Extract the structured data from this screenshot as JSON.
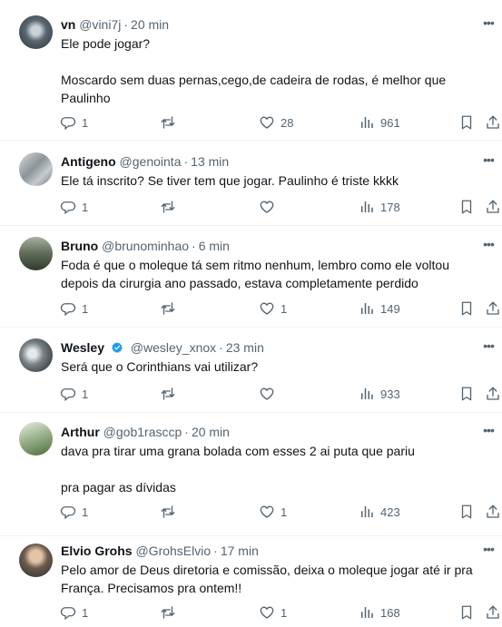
{
  "tweets": [
    {
      "name": "vn",
      "handle": "@vini7j",
      "time": "20 min",
      "text": "Ele pode jogar?\n\nMoscardo sem duas pernas,cego,de cadeira de rodas, é melhor que Paulinho",
      "replies": "1",
      "retweets": "",
      "likes": "28",
      "views": "961"
    },
    {
      "name": "Antigeno",
      "handle": "@genointa",
      "time": "13 min",
      "text": "Ele tá inscrito? Se tiver tem que jogar. Paulinho é triste kkkk",
      "replies": "1",
      "retweets": "",
      "likes": "",
      "views": "178"
    },
    {
      "name": "Bruno",
      "handle": "@brunominhao",
      "time": "6 min",
      "text": "Foda é que o moleque tá sem ritmo nenhum, lembro como ele voltou depois da cirurgia ano passado, estava completamente perdido",
      "replies": "1",
      "retweets": "",
      "likes": "1",
      "views": "149"
    },
    {
      "name": "Wesley",
      "handle": "@wesley_xnox",
      "time": "23 min",
      "text": "Será que o Corinthians vai utilizar?",
      "replies": "1",
      "retweets": "",
      "likes": "",
      "views": "933"
    },
    {
      "name": "Arthur",
      "handle": "@gob1rasccp",
      "time": "20 min",
      "text": "dava pra tirar uma grana bolada com esses 2 ai puta que pariu\n\npra pagar as dívidas",
      "replies": "1",
      "retweets": "",
      "likes": "1",
      "views": "423"
    },
    {
      "name": "Elvio Grohs",
      "handle": "@GrohsElvio",
      "time": "17 min",
      "text": "Pelo amor de Deus diretoria e comissão, deixa o moleque jogar até ir pra França. Precisamos pra ontem!!",
      "replies": "1",
      "retweets": "",
      "likes": "1",
      "views": "168"
    }
  ],
  "colors": {
    "text": "#0f1419",
    "muted": "#536471",
    "divider": "#eff3f4",
    "badge": "#1d9bf0"
  },
  "icons": [
    "reply-icon",
    "retweet-icon",
    "like-icon",
    "views-icon",
    "bookmark-icon",
    "share-icon",
    "more-icon",
    "verified-icon"
  ]
}
